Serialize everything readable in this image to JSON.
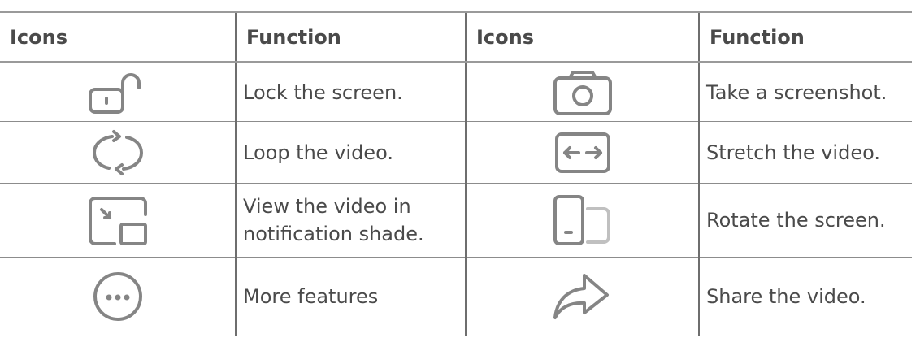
{
  "table": {
    "headers": [
      "Icons",
      "Function",
      "Icons",
      "Function"
    ],
    "rows": [
      {
        "left_icon": "unlock-icon",
        "left_function": "Lock the screen.",
        "right_icon": "camera-icon",
        "right_function": "Take a screenshot."
      },
      {
        "left_icon": "loop-icon",
        "left_function": "Loop the video.",
        "right_icon": "stretch-icon",
        "right_function": "Stretch the video."
      },
      {
        "left_icon": "picture-in-picture-icon",
        "left_function": "View the video in notification shade.",
        "right_icon": "rotate-screen-icon",
        "right_function": "Rotate the screen."
      },
      {
        "left_icon": "more-icon",
        "left_function": "More features",
        "right_icon": "share-icon",
        "right_function": "Share the video."
      }
    ]
  },
  "colors": {
    "text": "#4a4a4a",
    "icon_stroke": "#858585",
    "rule": "#9a9a9a"
  }
}
